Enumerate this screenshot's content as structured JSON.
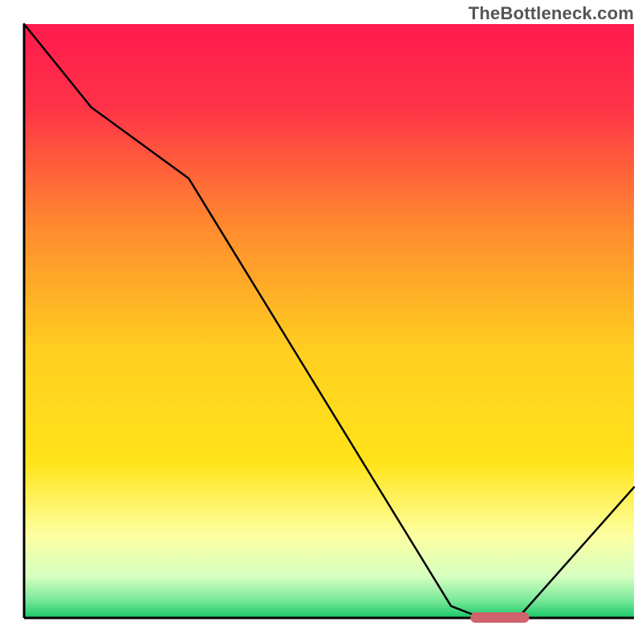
{
  "branding": {
    "sitename": "TheBottleneck.com"
  },
  "chart_data": {
    "type": "line",
    "title": "",
    "xlabel": "",
    "ylabel": "",
    "x_range": [
      0,
      100
    ],
    "y_range": [
      0,
      100
    ],
    "grid": false,
    "legend": false,
    "series": [
      {
        "name": "bottleneck-curve",
        "color": "#000000",
        "x": [
          0,
          11,
          27,
          70,
          75,
          81,
          100
        ],
        "values": [
          100,
          86,
          74,
          2,
          0,
          0,
          22
        ]
      }
    ],
    "marker": {
      "name": "optimal-band",
      "x_center": 78,
      "x_halfwidth_pct": 4.8,
      "y": 0,
      "color": "#d1636d"
    },
    "background_gradient": {
      "top_color": "#ff1a4e",
      "mid_colors": [
        "#ff6b37",
        "#ffe41a",
        "#f7ffb0"
      ],
      "bottom_color": "#18c968"
    }
  }
}
